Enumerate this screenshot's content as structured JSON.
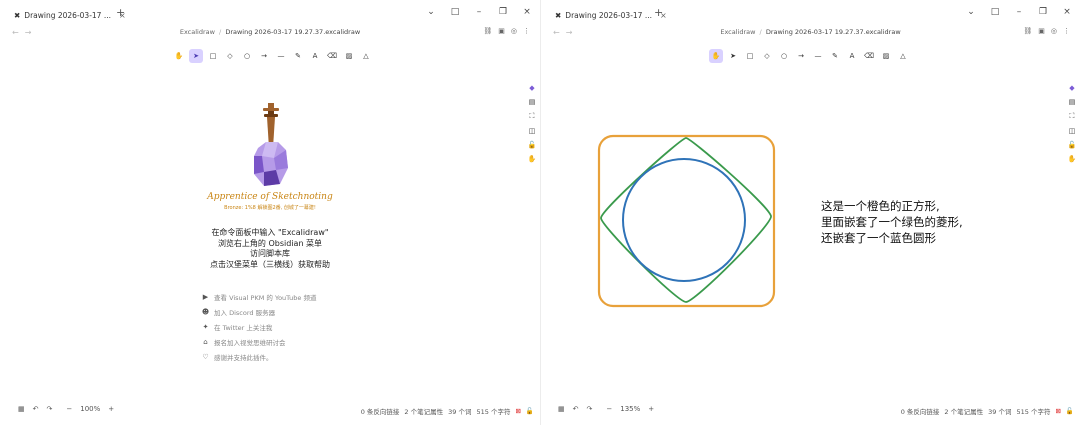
{
  "left": {
    "tab": {
      "icon": "excalidraw-icon",
      "title": "Drawing 2026-03-17 ...",
      "close": "×"
    },
    "tab_add": "+",
    "window_controls": [
      "⌄",
      "□",
      "–",
      "❐",
      "×"
    ],
    "breadcrumb": {
      "parent": "Excalidraw",
      "separator": "/",
      "current": "Drawing 2026-03-17 19.27.37.excalidraw"
    },
    "toolbar": [
      "hand-tool",
      "selection-tool",
      "rectangle-tool",
      "diamond-tool",
      "ellipse-tool",
      "arrow-tool",
      "line-tool",
      "draw-tool",
      "text-tool",
      "eraser-tool",
      "image-tool",
      "library-tool"
    ],
    "active_tool": "selection-tool",
    "welcome": {
      "app_name": "Apprentice of Sketchnoting",
      "rank": "Bronze: 1%8 解锁图2番, 创城了一幕建!",
      "instructions": [
        "在命令面板中输入 \"Excalidraw\"",
        "浏览右上角的 Obsidian 菜单",
        "访问脚本库",
        "点击汉堡菜单（三横线）获取帮助"
      ],
      "links": [
        {
          "icon": "youtube-icon",
          "text": "查看 Visual PKM 的 YouTube 频道"
        },
        {
          "icon": "discord-icon",
          "text": "加入 Discord 服务器"
        },
        {
          "icon": "twitter-icon",
          "text": "在 Twitter 上关注我"
        },
        {
          "icon": "graduation-cap-icon",
          "text": "报名加入视觉思维研讨会"
        },
        {
          "icon": "heart-icon",
          "text": "感谢并支持此插件。"
        }
      ]
    },
    "zoom": "100%",
    "status": {
      "backlinks": "0 条反向链接",
      "properties": "2 个笔记属性",
      "words": "39 个词",
      "chars": "515 个字符"
    }
  },
  "right": {
    "tab": {
      "icon": "excalidraw-icon",
      "title": "Drawing 2026-03-17 ...",
      "close": "×"
    },
    "tab_add": "+",
    "window_controls": [
      "⌄",
      "□",
      "–",
      "❐",
      "×"
    ],
    "breadcrumb": {
      "parent": "Excalidraw",
      "separator": "/",
      "current": "Drawing 2026-03-17 19.27.37.excalidraw"
    },
    "active_tool": "hand-tool",
    "zoom": "135%",
    "annotation": [
      "这是一个橙色的正方形,",
      "里面嵌套了一个绿色的菱形,",
      "还嵌套了一个蓝色圆形"
    ],
    "shape_colors": {
      "square": "#e8a13a",
      "diamond": "#3a9a4c",
      "circle": "#2f73b8"
    },
    "status": {
      "backlinks": "0 条反向链接",
      "properties": "2 个笔记属性",
      "words": "39 个词",
      "chars": "515 个字符"
    }
  },
  "colors": {
    "accent": "#d9d1ff",
    "brand_orange": "#c98514"
  }
}
